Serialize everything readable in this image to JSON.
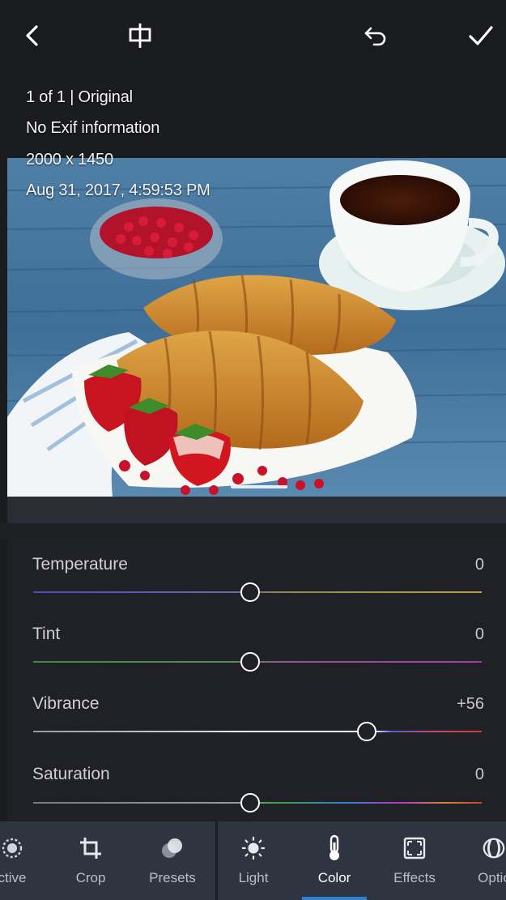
{
  "info": {
    "line1": "1 of 1 | Original",
    "line2": "No Exif information",
    "line3": "2000 x 1450",
    "line4": "Aug 31, 2017, 4:59:53 PM"
  },
  "sliders": [
    {
      "label": "Temperature",
      "value": "0",
      "position": 0.5
    },
    {
      "label": "Tint",
      "value": "0",
      "position": 0.5
    },
    {
      "label": "Vibrance",
      "value": "+56",
      "position": 0.78
    },
    {
      "label": "Saturation",
      "value": "0",
      "position": 0.5
    }
  ],
  "tools": [
    {
      "label": "ctive",
      "icon": "selective-icon"
    },
    {
      "label": "Crop",
      "icon": "crop-icon"
    },
    {
      "label": "Presets",
      "icon": "presets-icon"
    },
    {
      "label": "Light",
      "icon": "sun-icon"
    },
    {
      "label": "Color",
      "icon": "thermometer-icon",
      "active": true
    },
    {
      "label": "Effects",
      "icon": "effects-icon"
    },
    {
      "label": "Optic",
      "icon": "optics-icon"
    }
  ],
  "colors": {
    "accent": "#2c80d6",
    "toolbar": "#2e3440",
    "panel": "#202126"
  }
}
